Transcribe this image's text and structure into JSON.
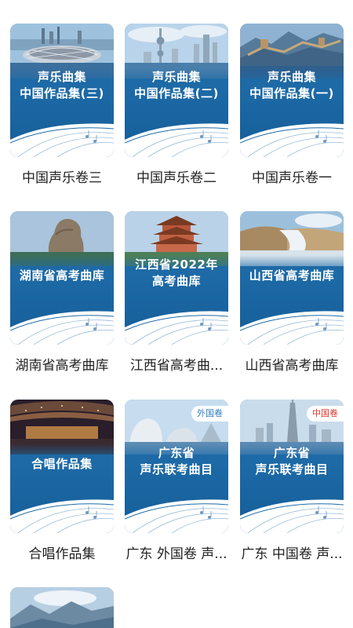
{
  "cards": [
    {
      "title_line1": "声乐曲集",
      "title_line2": "中国作品集(三)",
      "caption": "中国声乐卷三",
      "scene": "stadium"
    },
    {
      "title_line1": "声乐曲集",
      "title_line2": "中国作品集(二)",
      "caption": "中国声乐卷二",
      "scene": "skyline"
    },
    {
      "title_line1": "声乐曲集",
      "title_line2": "中国作品集(一)",
      "caption": "中国声乐卷一",
      "scene": "great-wall"
    },
    {
      "title_line1": "湖南省高考曲库",
      "title_line2": "",
      "caption": "湖南省高考曲库",
      "scene": "statue"
    },
    {
      "title_line1": "江西省2022年",
      "title_line2": "高考曲库",
      "caption": "江西省高考曲...",
      "scene": "pavilion"
    },
    {
      "title_line1": "山西省高考曲库",
      "title_line2": "",
      "caption": "山西省高考曲库",
      "scene": "waterfall"
    },
    {
      "title_line1": "合唱作品集",
      "title_line2": "",
      "caption": "合唱作品集",
      "scene": "concert-hall"
    },
    {
      "title_line1": "广东省",
      "title_line2": "声乐联考曲目",
      "caption": "广东 外国卷 声...",
      "scene": "opera-house",
      "badge": "外国卷",
      "badge_color": "#2b78c2"
    },
    {
      "title_line1": "广东省",
      "title_line2": "声乐联考曲目",
      "caption": "广东 中国卷 声...",
      "scene": "canton-tower",
      "badge": "中国卷",
      "badge_color": "#d9342b"
    },
    {
      "title_line1": "",
      "title_line2": "",
      "caption": "",
      "scene": "mountains"
    }
  ]
}
